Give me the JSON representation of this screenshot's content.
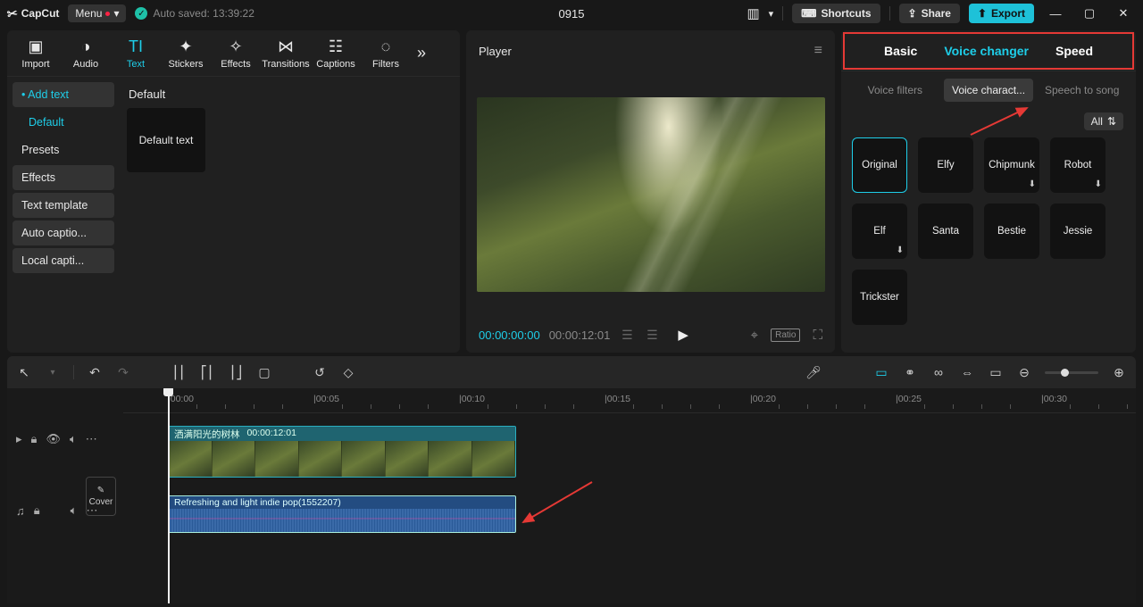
{
  "titlebar": {
    "app": "CapCut",
    "menu": "Menu",
    "autosaved": "Auto saved: 13:39:22",
    "project": "0915",
    "shortcuts": "Shortcuts",
    "share": "Share",
    "export": "Export"
  },
  "media_tabs": [
    {
      "label": "Import",
      "icon": "▣"
    },
    {
      "label": "Audio",
      "icon": "◑"
    },
    {
      "label": "Text",
      "icon": "TI",
      "active": true
    },
    {
      "label": "Stickers",
      "icon": "✦"
    },
    {
      "label": "Effects",
      "icon": "✧"
    },
    {
      "label": "Transitions",
      "icon": "⋈"
    },
    {
      "label": "Captions",
      "icon": "☷"
    },
    {
      "label": "Filters",
      "icon": "◌"
    }
  ],
  "sidebar_items": [
    {
      "label": "• Add text",
      "cls": "highlight active"
    },
    {
      "label": "Default",
      "cls": "sub"
    },
    {
      "label": "Presets",
      "cls": ""
    },
    {
      "label": "Effects",
      "cls": "active"
    },
    {
      "label": "Text template",
      "cls": "active"
    },
    {
      "label": "Auto captio...",
      "cls": "active"
    },
    {
      "label": "Local capti...",
      "cls": "active"
    }
  ],
  "content": {
    "header": "Default",
    "tile": "Default text"
  },
  "player": {
    "title": "Player",
    "tc_current": "00:00:00:00",
    "tc_duration": "00:00:12:01",
    "ratio": "Ratio"
  },
  "inspector_tabs": [
    {
      "label": "Basic"
    },
    {
      "label": "Voice changer",
      "active": true
    },
    {
      "label": "Speed"
    }
  ],
  "sub_tabs": [
    {
      "label": "Voice filters"
    },
    {
      "label": "Voice charact...",
      "active": true
    },
    {
      "label": "Speech to song"
    }
  ],
  "filter_all": "All",
  "voices": [
    {
      "name": "Original",
      "selected": true
    },
    {
      "name": "Elfy"
    },
    {
      "name": "Chipmunk",
      "dl": true
    },
    {
      "name": "Robot",
      "dl": true
    },
    {
      "name": "Elf",
      "dl": true
    },
    {
      "name": "Santa"
    },
    {
      "name": "Bestie"
    },
    {
      "name": "Jessie"
    },
    {
      "name": "Trickster"
    }
  ],
  "timeline": {
    "ruler": [
      "|00:00",
      "|00:05",
      "|00:10",
      "|00:15",
      "|00:20",
      "|00:25",
      "|00:30"
    ],
    "cover": "Cover",
    "video_name": "洒满阳光的树林",
    "video_dur": "00:00:12:01",
    "audio_name": "Refreshing and light indie pop(1552207)"
  }
}
